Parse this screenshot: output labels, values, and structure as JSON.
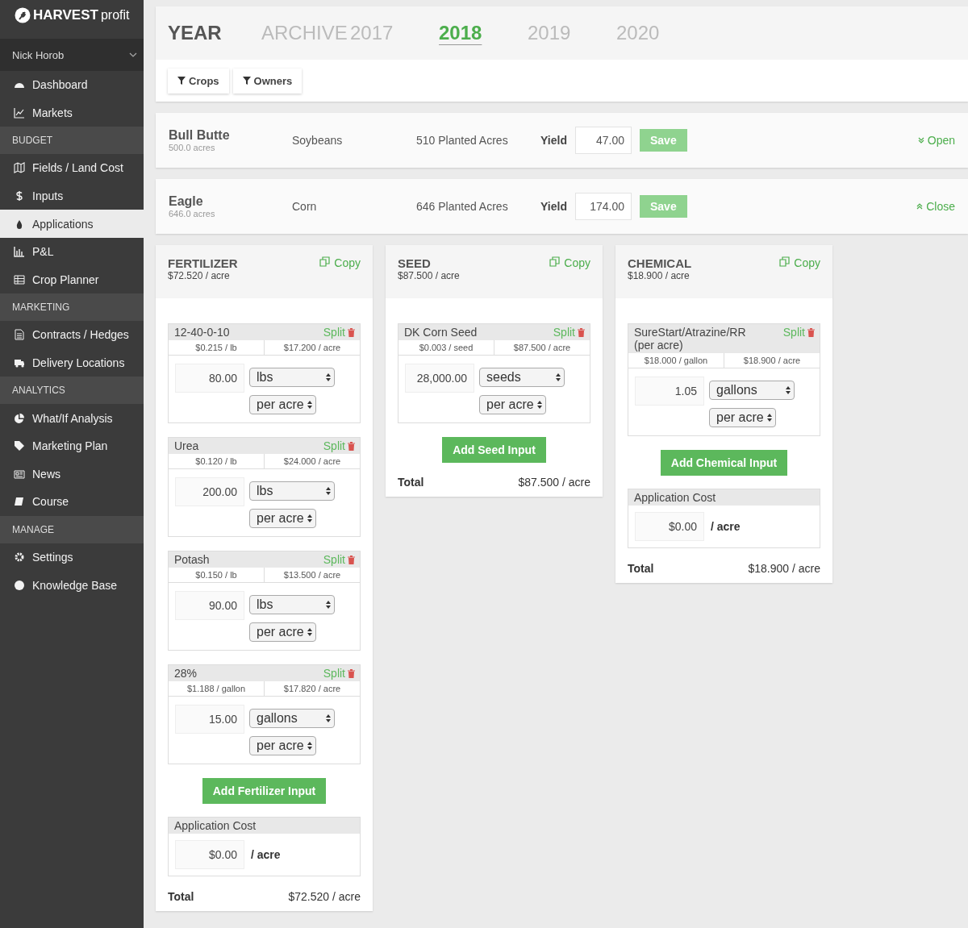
{
  "brand": {
    "name": "HARVEST",
    "suffix": "profit"
  },
  "user": {
    "name": "Nick Horob"
  },
  "sidebar": {
    "items": [
      {
        "kind": "item",
        "label": "Dashboard",
        "selected": false
      },
      {
        "kind": "item",
        "label": "Markets",
        "selected": false
      },
      {
        "kind": "section",
        "label": "BUDGET"
      },
      {
        "kind": "item",
        "label": "Fields / Land Cost",
        "selected": false
      },
      {
        "kind": "item",
        "label": "Inputs",
        "selected": false
      },
      {
        "kind": "item",
        "label": "Applications",
        "selected": true
      },
      {
        "kind": "item",
        "label": "P&L",
        "selected": false
      },
      {
        "kind": "item",
        "label": "Crop Planner",
        "selected": false
      },
      {
        "kind": "section",
        "label": "MARKETING"
      },
      {
        "kind": "item",
        "label": "Contracts / Hedges",
        "selected": false
      },
      {
        "kind": "item",
        "label": "Delivery Locations",
        "selected": false
      },
      {
        "kind": "section",
        "label": "ANALYTICS"
      },
      {
        "kind": "item",
        "label": "What/If Analysis",
        "selected": false
      },
      {
        "kind": "item",
        "label": "Marketing Plan",
        "selected": false
      },
      {
        "kind": "item",
        "label": "News",
        "selected": false
      },
      {
        "kind": "item",
        "label": "Course",
        "selected": false
      },
      {
        "kind": "section",
        "label": "MANAGE"
      },
      {
        "kind": "item",
        "label": "Settings",
        "selected": false
      },
      {
        "kind": "item",
        "label": "Knowledge Base",
        "selected": false
      }
    ]
  },
  "year_bar": {
    "label": "YEAR",
    "tabs": [
      {
        "label": "ARCHIVE",
        "selected": false
      },
      {
        "label": "2017",
        "selected": false
      },
      {
        "label": "2018",
        "selected": true
      },
      {
        "label": "2019",
        "selected": false
      },
      {
        "label": "2020",
        "selected": false
      }
    ]
  },
  "filters": [
    "Crops",
    "Owners"
  ],
  "fields": [
    {
      "name": "Bull Butte",
      "acres": "500.0 acres",
      "crop": "Soybeans",
      "planted": "510 Planted Acres",
      "yield_label": "Yield",
      "yield": "47.00",
      "save": "Save",
      "toggle": "Open",
      "expanded": false
    },
    {
      "name": "Eagle",
      "acres": "646.0 acres",
      "crop": "Corn",
      "planted": "646 Planted Acres",
      "yield_label": "Yield",
      "yield": "174.00",
      "save": "Save",
      "toggle": "Close",
      "expanded": true
    }
  ],
  "cards": [
    {
      "title": "FERTILIZER",
      "cost": "$72.520 / acre",
      "copy": "Copy",
      "items": [
        {
          "name": "12-40-0-10",
          "split": "Split",
          "unit_price": "$0.215 / lb",
          "per_acre": "$17.200 / acre",
          "amount": "80.00",
          "unit": "lbs",
          "rate": "per acre"
        },
        {
          "name": "Urea",
          "split": "Split",
          "unit_price": "$0.120 / lb",
          "per_acre": "$24.000 / acre",
          "amount": "200.00",
          "unit": "lbs",
          "rate": "per acre"
        },
        {
          "name": "Potash",
          "split": "Split",
          "unit_price": "$0.150 / lb",
          "per_acre": "$13.500 / acre",
          "amount": "90.00",
          "unit": "lbs",
          "rate": "per acre"
        },
        {
          "name": "28%",
          "split": "Split",
          "unit_price": "$1.188 / gallon",
          "per_acre": "$17.820 / acre",
          "amount": "15.00",
          "unit": "gallons",
          "rate": "per acre"
        }
      ],
      "add": "Add Fertilizer Input",
      "application": {
        "label": "Application Cost",
        "value": "$0.00",
        "unit": "/ acre"
      },
      "total_label": "Total",
      "total": "$72.520 / acre"
    },
    {
      "title": "SEED",
      "cost": "$87.500 / acre",
      "copy": "Copy",
      "items": [
        {
          "name": "DK Corn Seed",
          "split": "Split",
          "unit_price": "$0.003 / seed",
          "per_acre": "$87.500 / acre",
          "amount": "28,000.00",
          "unit": "seeds",
          "rate": "per acre"
        }
      ],
      "add": "Add Seed Input",
      "total_label": "Total",
      "total": "$87.500 / acre"
    },
    {
      "title": "CHEMICAL",
      "cost": "$18.900 / acre",
      "copy": "Copy",
      "items": [
        {
          "name": "SureStart/Atrazine/RR (per acre)",
          "split": "Split",
          "unit_price": "$18.000 / gallon",
          "per_acre": "$18.900 / acre",
          "amount": "1.05",
          "unit": "gallons",
          "rate": "per acre"
        }
      ],
      "add": "Add Chemical Input",
      "application": {
        "label": "Application Cost",
        "value": "$0.00",
        "unit": "/ acre"
      },
      "total_label": "Total",
      "total": "$18.900 / acre"
    }
  ]
}
